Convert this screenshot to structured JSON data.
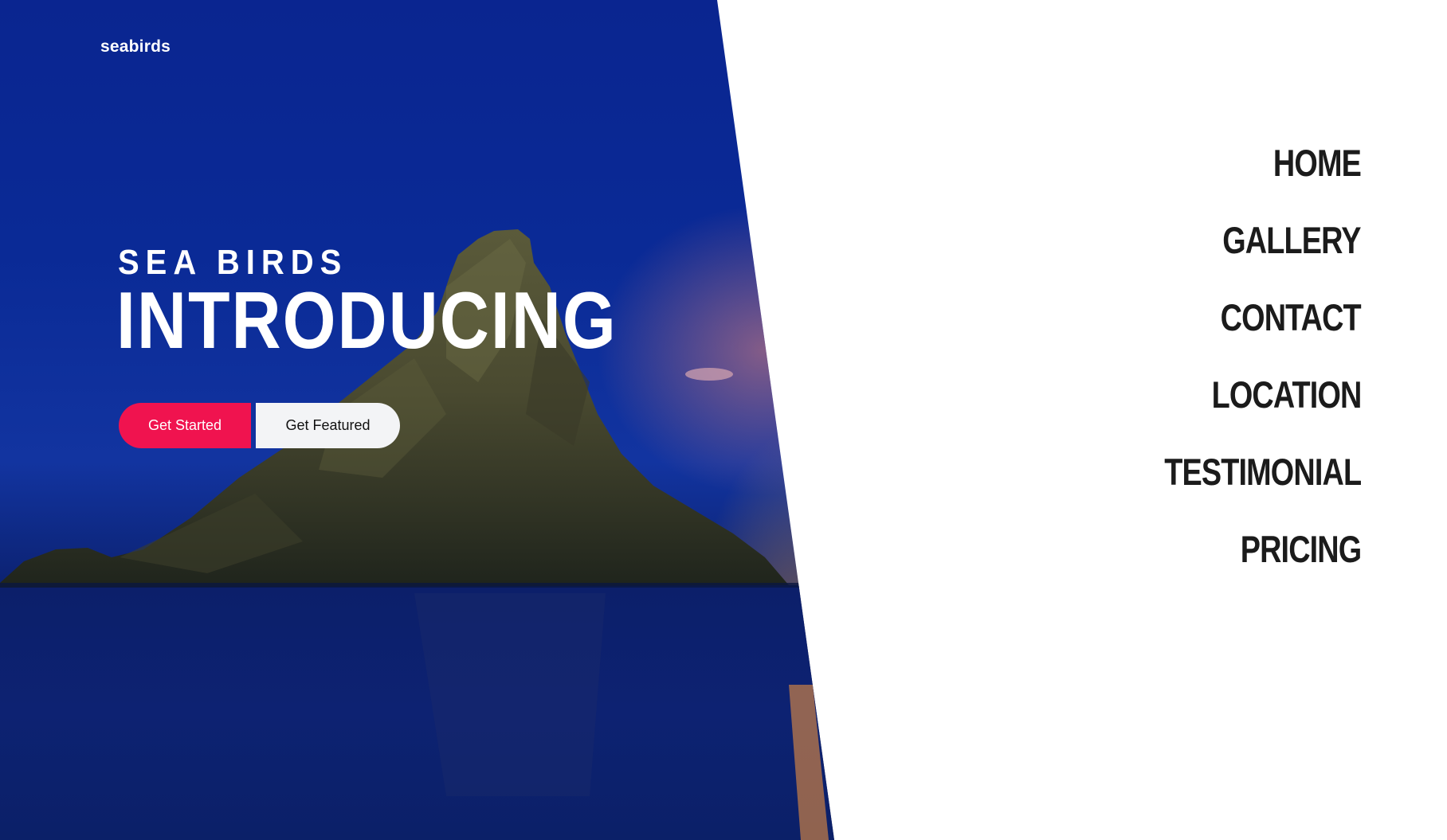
{
  "brand": {
    "logo": "seabirds"
  },
  "hero": {
    "subtitle": "SEA BIRDS",
    "headline": "INTRODUCING",
    "buttons": {
      "primary_label": "Get Started",
      "secondary_label": "Get Featured"
    }
  },
  "nav": {
    "items": [
      {
        "label": "HOME"
      },
      {
        "label": "GALLERY"
      },
      {
        "label": "CONTACT"
      },
      {
        "label": "LOCATION"
      },
      {
        "label": "TESTIMONIAL"
      },
      {
        "label": "PRICING"
      }
    ]
  },
  "colors": {
    "primary_button": "#f0134f",
    "secondary_button": "#f3f4f6",
    "hero_sky": "#0a2a96",
    "nav_text": "#1b1b1b"
  }
}
